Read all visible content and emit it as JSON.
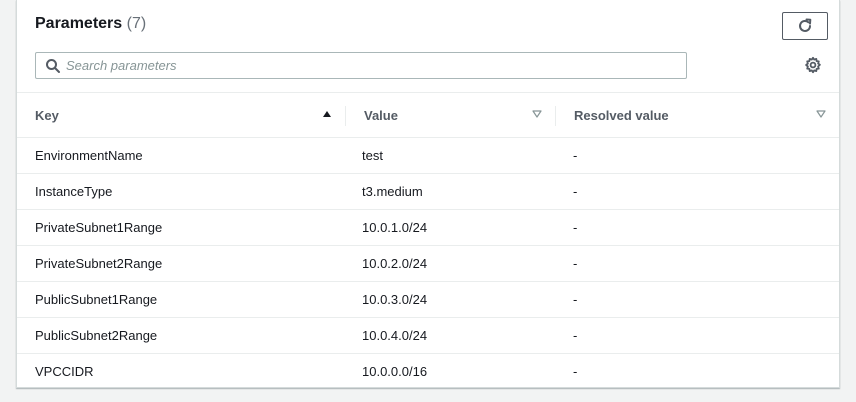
{
  "panel": {
    "title": "Parameters",
    "count": "(7)"
  },
  "search": {
    "placeholder": "Search parameters",
    "value": ""
  },
  "columns": {
    "key": "Key",
    "value": "Value",
    "resolved": "Resolved value"
  },
  "sort": {
    "column": "Key",
    "direction": "ascending"
  },
  "rows": [
    {
      "key": "EnvironmentName",
      "value": "test",
      "resolved": "-"
    },
    {
      "key": "InstanceType",
      "value": "t3.medium",
      "resolved": "-"
    },
    {
      "key": "PrivateSubnet1Range",
      "value": "10.0.1.0/24",
      "resolved": "-"
    },
    {
      "key": "PrivateSubnet2Range",
      "value": "10.0.2.0/24",
      "resolved": "-"
    },
    {
      "key": "PublicSubnet1Range",
      "value": "10.0.3.0/24",
      "resolved": "-"
    },
    {
      "key": "PublicSubnet2Range",
      "value": "10.0.4.0/24",
      "resolved": "-"
    },
    {
      "key": "VPCCIDR",
      "value": "10.0.0.0/16",
      "resolved": "-"
    }
  ],
  "icons": {
    "refresh": "refresh-icon",
    "search": "search-icon",
    "settings": "gear-icon",
    "sort_active": "caret-up-icon",
    "sort_inactive": "caret-down-outline-icon"
  },
  "colors": {
    "text": "#16191f",
    "muted": "#687078",
    "header_text": "#545b64",
    "border": "#eaeded",
    "background": "#f2f3f3"
  }
}
